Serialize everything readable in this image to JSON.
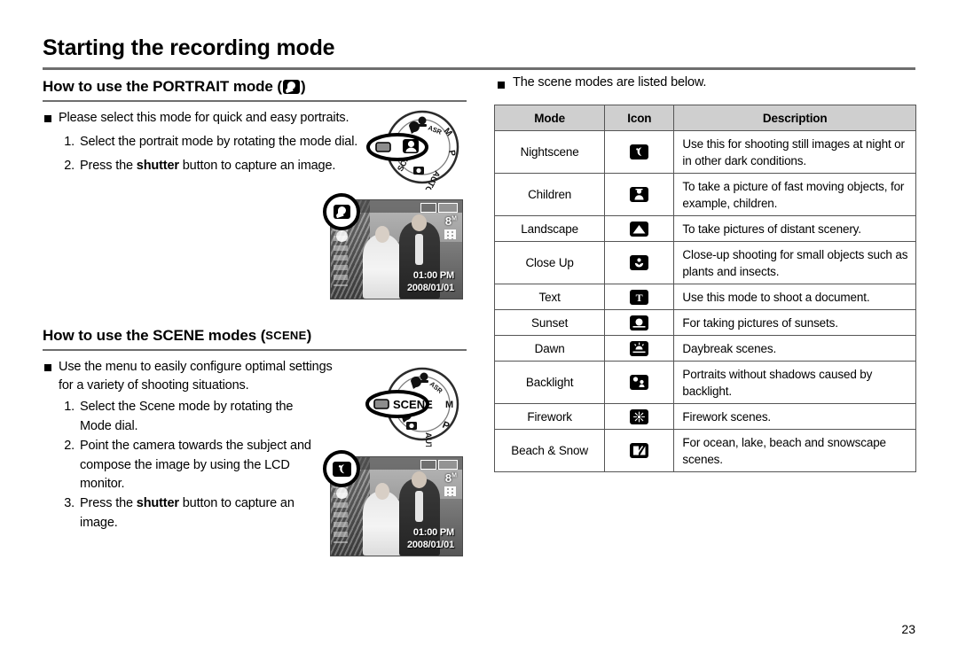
{
  "page": {
    "title": "Starting the recording mode",
    "number": "23"
  },
  "sections": {
    "portrait": {
      "heading_prefix": "How to use the PORTRAIT mode (",
      "heading_suffix": ")",
      "heading_icon": "portrait-mode-icon",
      "bullet": "Please select this mode for quick and easy portraits.",
      "steps": [
        {
          "num": "1.",
          "text": "Select the portrait mode by rotating the mode dial."
        },
        {
          "num": "2.",
          "text_before": "Press the ",
          "bold": "shutter",
          "text_after": " button to capture an image."
        }
      ],
      "dial_label": "mode-dial-portrait",
      "dial_markings": [
        "M",
        "P",
        "AUTO",
        "SCENE"
      ],
      "lcd": {
        "badge_icon": "portrait-mode-icon",
        "resolution": "8",
        "resolution_sup": "M",
        "time": "01:00 PM",
        "date": "2008/01/01"
      }
    },
    "scene": {
      "heading_prefix": "How to use the SCENE modes (",
      "heading_mark": "SCENE",
      "heading_suffix": ")",
      "bullet": "Use the menu to easily configure optimal settings for a variety of shooting situations.",
      "steps": [
        {
          "num": "1.",
          "text": "Select the Scene mode by rotating the Mode dial."
        },
        {
          "num": "2.",
          "text": "Point the camera towards the subject and compose the image by using the LCD monitor."
        },
        {
          "num": "3.",
          "text_before": "Press the ",
          "bold": "shutter",
          "text_after": " button to capture an image."
        }
      ],
      "dial_label": "mode-dial-scene",
      "dial_markings": [
        "M",
        "P",
        "AUTO",
        "SCENE"
      ],
      "lcd": {
        "badge_icon": "nightscene-icon",
        "resolution": "8",
        "resolution_sup": "M",
        "time": "01:00 PM",
        "date": "2008/01/01"
      }
    }
  },
  "scene_table": {
    "intro_bullet": "The scene modes are listed below.",
    "headers": [
      "Mode",
      "Icon",
      "Description"
    ],
    "header_bg": "#cfcfcf",
    "rows": [
      {
        "mode": "Nightscene",
        "icon": "nightscene-icon",
        "description": "Use this for shooting still images at night or in other dark conditions.",
        "lines": 2
      },
      {
        "mode": "Children",
        "icon": "children-icon",
        "description": "To take a picture of fast moving objects, for example, children.",
        "lines": 2
      },
      {
        "mode": "Landscape",
        "icon": "landscape-icon",
        "description": "To take pictures of distant scenery.",
        "lines": 1
      },
      {
        "mode": "Close Up",
        "icon": "closeup-icon",
        "description": "Close-up shooting for small objects such as plants and insects.",
        "lines": 2
      },
      {
        "mode": "Text",
        "icon": "text-icon",
        "description": "Use this mode to shoot a document.",
        "lines": 1
      },
      {
        "mode": "Sunset",
        "icon": "sunset-icon",
        "description": "For taking pictures of sunsets.",
        "lines": 1
      },
      {
        "mode": "Dawn",
        "icon": "dawn-icon",
        "description": "Daybreak scenes.",
        "lines": 1
      },
      {
        "mode": "Backlight",
        "icon": "backlight-icon",
        "description": "Portraits without shadows caused by backlight.",
        "lines": 2
      },
      {
        "mode": "Firework",
        "icon": "firework-icon",
        "description": "Firework scenes.",
        "lines": 1
      },
      {
        "mode": "Beach & Snow",
        "icon": "beachsnow-icon",
        "description": "For ocean, lake, beach and snowscape scenes.",
        "lines": 2
      }
    ]
  }
}
